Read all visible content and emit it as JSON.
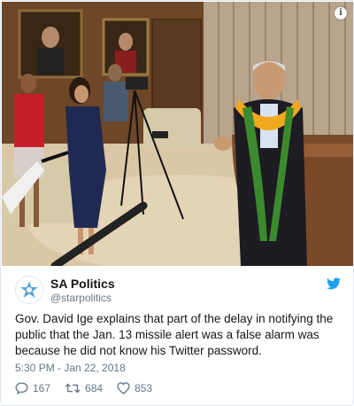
{
  "tweet": {
    "display_name": "SA Politics",
    "handle": "@starpolitics",
    "text": "Gov. David Ige explains that part of the delay in notifying the public that the Jan. 13 missile alert was a false alarm was because he did not know his Twitter password.",
    "timestamp": "5:30 PM - Jan 22, 2018",
    "replies": "167",
    "retweets": "684",
    "likes": "853"
  },
  "icons": {
    "avatar": "star-advertiser-logo-icon",
    "brand": "twitter-bird-icon",
    "info": "info-icon",
    "reply": "reply-icon",
    "retweet": "retweet-icon",
    "like": "heart-icon"
  },
  "colors": {
    "twitter_blue": "#1da1f2",
    "secondary_text": "#657786",
    "lei_yellow": "#f2a81e",
    "lei_green": "#3c8a2e"
  }
}
